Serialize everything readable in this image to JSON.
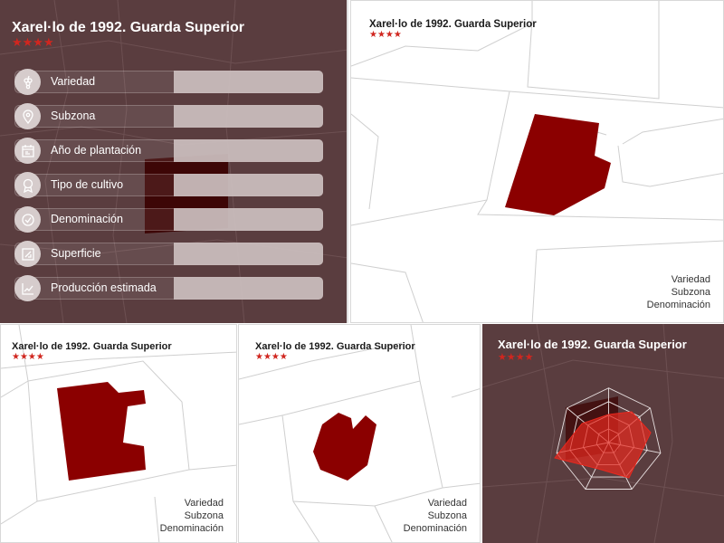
{
  "title": "Xarel·lo de 1992. Guarda Superior",
  "stars": "★★★★",
  "fields": [
    {
      "label": "Variedad",
      "icon": "grape-icon"
    },
    {
      "label": "Subzona",
      "icon": "location-pin-icon"
    },
    {
      "label": "Año de plantación",
      "icon": "calendar-icon"
    },
    {
      "label": "Tipo de cultivo",
      "icon": "award-icon"
    },
    {
      "label": "Denominación",
      "icon": "check-badge-icon"
    },
    {
      "label": "Superficie",
      "icon": "area-icon"
    },
    {
      "label": "Producción estimada",
      "icon": "chart-icon"
    }
  ],
  "legend": [
    "Variedad",
    "Subzona",
    "Denominación"
  ],
  "colors": {
    "panel_dark": "#5a3d3f",
    "plot_fill": "#8b0000",
    "star": "#d0261f",
    "radar_fill": "#e8281e"
  }
}
